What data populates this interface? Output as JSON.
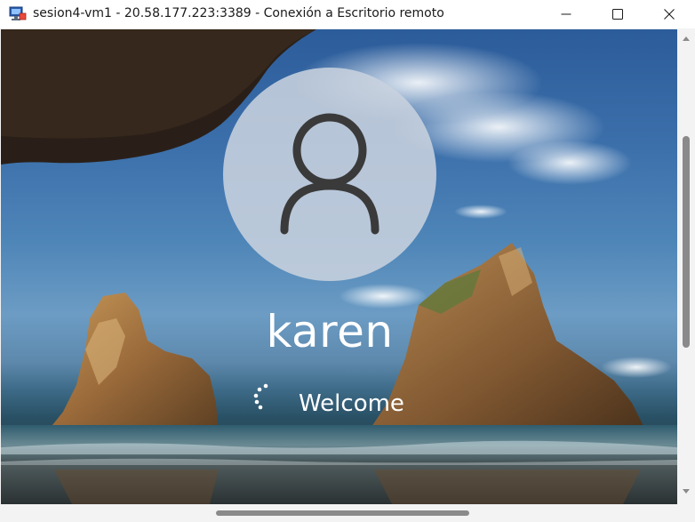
{
  "window": {
    "title": "sesion4-vm1 - 20.58.177.223:3389 - Conexión a Escritorio remoto",
    "app_icon": "remote-desktop-icon",
    "controls": {
      "minimize_icon": "minimize-icon",
      "maximize_icon": "maximize-icon",
      "close_icon": "close-icon"
    }
  },
  "login_screen": {
    "avatar_icon": "user-icon",
    "username": "karen",
    "status_text": "Welcome",
    "spinner_icon": "loading-spinner-icon"
  },
  "colors": {
    "titlebar_bg": "#ffffff",
    "avatar_bg": "#c8d2de",
    "text_color": "#ffffff",
    "scroll_thumb": "#8a8a8a"
  }
}
